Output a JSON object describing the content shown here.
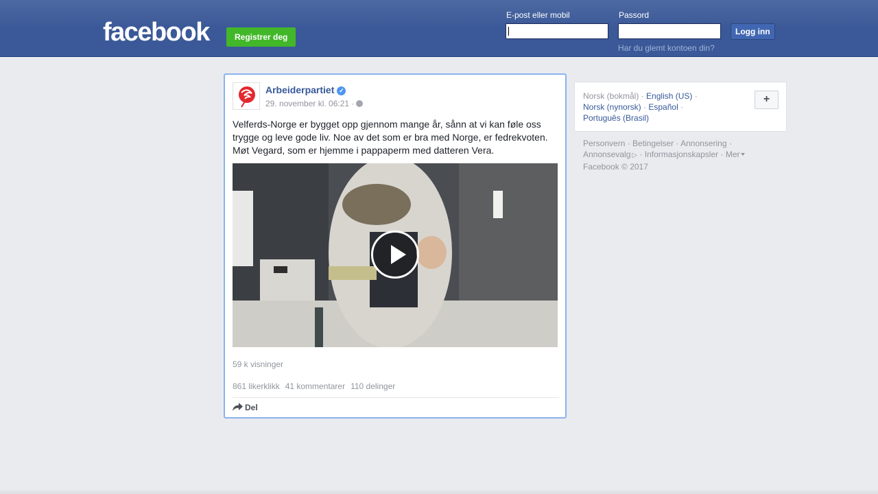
{
  "header": {
    "logo": "facebook",
    "register_label": "Registrer deg",
    "email_label": "E-post eller mobil",
    "email_value": "",
    "password_label": "Passord",
    "password_value": "",
    "login_label": "Logg inn",
    "forgot_label": "Har du glemt kontoen din?"
  },
  "post": {
    "page_name": "Arbeiderpartiet",
    "verified_icon": "verified-checkmark-icon",
    "timestamp": "29. november kl. 06:21 ·",
    "privacy_icon": "globe-icon",
    "text": "Velferds-Norge er bygget opp gjennom mange år, sånn at vi kan føle oss trygge og leve gode liv. Noe av det som er bra med Norge, er fedrekvoten. Møt Vegard, som er hjemme i pappaperm med datteren Vera.",
    "views": "59 k visninger",
    "likes": "861 likerklikk",
    "comments": "41 kommentarer",
    "shares": "110 delinger",
    "share_label": "Del",
    "colors": {
      "link": "#365899",
      "border_highlight": "#8bb2f0"
    }
  },
  "languages": {
    "current": "Norsk (bokmål)",
    "links": [
      "English (US)",
      "Norsk (nynorsk)",
      "Español",
      "Português (Brasil)"
    ],
    "add_label": "+"
  },
  "footer": {
    "links": [
      "Personvern",
      "Betingelser",
      "Annonsering",
      "Annonsevalg",
      "Informasjonskapsler",
      "Mer"
    ],
    "copyright": "Facebook © 2017"
  },
  "colors": {
    "header": "#3b5998",
    "register": "#42b72a",
    "background": "#e9ebee"
  }
}
